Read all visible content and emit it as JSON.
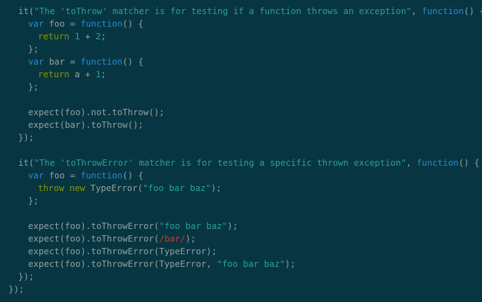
{
  "editor": {
    "theme_colors": {
      "background": "#073642",
      "plain": "#93a1a1",
      "string": "#2aa198",
      "keyword": "#268bd2",
      "control": "#859900",
      "regex": "#dc322f"
    },
    "lines": [
      {
        "indent": 1,
        "tokens": [
          {
            "t": "it(",
            "c": "plain"
          },
          {
            "t": "\"The 'toThrow' matcher is for testing if a function throws an exception\"",
            "c": "str"
          },
          {
            "t": ", ",
            "c": "plain"
          },
          {
            "t": "function",
            "c": "kw"
          },
          {
            "t": "() {",
            "c": "plain"
          }
        ]
      },
      {
        "indent": 2,
        "tokens": [
          {
            "t": "var",
            "c": "kw"
          },
          {
            "t": " foo = ",
            "c": "plain"
          },
          {
            "t": "function",
            "c": "kw"
          },
          {
            "t": "() {",
            "c": "plain"
          }
        ]
      },
      {
        "indent": 3,
        "tokens": [
          {
            "t": "return",
            "c": "ret"
          },
          {
            "t": " ",
            "c": "plain"
          },
          {
            "t": "1",
            "c": "num"
          },
          {
            "t": " + ",
            "c": "plain"
          },
          {
            "t": "2",
            "c": "num"
          },
          {
            "t": ";",
            "c": "plain"
          }
        ]
      },
      {
        "indent": 2,
        "tokens": [
          {
            "t": "};",
            "c": "plain"
          }
        ]
      },
      {
        "indent": 2,
        "tokens": [
          {
            "t": "var",
            "c": "kw"
          },
          {
            "t": " bar = ",
            "c": "plain"
          },
          {
            "t": "function",
            "c": "kw"
          },
          {
            "t": "() {",
            "c": "plain"
          }
        ]
      },
      {
        "indent": 3,
        "tokens": [
          {
            "t": "return",
            "c": "ret"
          },
          {
            "t": " a + ",
            "c": "plain"
          },
          {
            "t": "1",
            "c": "num"
          },
          {
            "t": ";",
            "c": "plain"
          }
        ]
      },
      {
        "indent": 2,
        "tokens": [
          {
            "t": "};",
            "c": "plain"
          }
        ]
      },
      {
        "indent": 2,
        "tokens": []
      },
      {
        "indent": 2,
        "tokens": [
          {
            "t": "expect(foo).not.toThrow();",
            "c": "plain"
          }
        ]
      },
      {
        "indent": 2,
        "tokens": [
          {
            "t": "expect(bar).toThrow();",
            "c": "plain"
          }
        ]
      },
      {
        "indent": 1,
        "tokens": [
          {
            "t": "});",
            "c": "plain"
          }
        ]
      },
      {
        "indent": 1,
        "tokens": []
      },
      {
        "indent": 1,
        "tokens": [
          {
            "t": "it(",
            "c": "plain"
          },
          {
            "t": "\"The 'toThrowError' matcher is for testing a specific thrown exception\"",
            "c": "str"
          },
          {
            "t": ", ",
            "c": "plain"
          },
          {
            "t": "function",
            "c": "kw"
          },
          {
            "t": "() {",
            "c": "plain"
          }
        ]
      },
      {
        "indent": 2,
        "tokens": [
          {
            "t": "var",
            "c": "kw"
          },
          {
            "t": " foo = ",
            "c": "plain"
          },
          {
            "t": "function",
            "c": "kw"
          },
          {
            "t": "() {",
            "c": "plain"
          }
        ]
      },
      {
        "indent": 3,
        "tokens": [
          {
            "t": "throw",
            "c": "ret"
          },
          {
            "t": " ",
            "c": "plain"
          },
          {
            "t": "new",
            "c": "ret"
          },
          {
            "t": " TypeError(",
            "c": "plain"
          },
          {
            "t": "\"foo bar baz\"",
            "c": "str"
          },
          {
            "t": ");",
            "c": "plain"
          }
        ]
      },
      {
        "indent": 2,
        "tokens": [
          {
            "t": "};",
            "c": "plain"
          }
        ]
      },
      {
        "indent": 2,
        "tokens": []
      },
      {
        "indent": 2,
        "tokens": [
          {
            "t": "expect(foo).toThrowError(",
            "c": "plain"
          },
          {
            "t": "\"foo bar baz\"",
            "c": "str"
          },
          {
            "t": ");",
            "c": "plain"
          }
        ]
      },
      {
        "indent": 2,
        "tokens": [
          {
            "t": "expect(foo).toThrowError(",
            "c": "plain"
          },
          {
            "t": "/bar/",
            "c": "regex"
          },
          {
            "t": ");",
            "c": "plain"
          }
        ]
      },
      {
        "indent": 2,
        "tokens": [
          {
            "t": "expect(foo).toThrowError(TypeError);",
            "c": "plain"
          }
        ]
      },
      {
        "indent": 2,
        "tokens": [
          {
            "t": "expect(foo).toThrowError(TypeError, ",
            "c": "plain"
          },
          {
            "t": "\"foo bar baz\"",
            "c": "str"
          },
          {
            "t": ");",
            "c": "plain"
          }
        ]
      },
      {
        "indent": 1,
        "tokens": [
          {
            "t": "});",
            "c": "plain"
          }
        ]
      },
      {
        "indent": 0,
        "tokens": [
          {
            "t": "});",
            "c": "plain"
          }
        ]
      }
    ]
  }
}
